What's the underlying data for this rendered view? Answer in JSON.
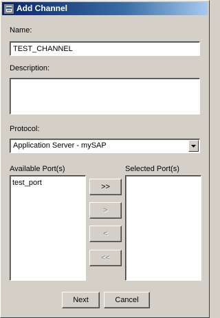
{
  "window": {
    "title": "Add Channel",
    "icon": "app-window-icon"
  },
  "form": {
    "name_label": "Name:",
    "name_value": "TEST_CHANNEL",
    "description_label": "Description:",
    "description_value": "",
    "protocol_label": "Protocol:",
    "protocol_value": "Application Server - mySAP"
  },
  "ports": {
    "available_label": "Available Port(s)",
    "selected_label": "Selected Port(s)",
    "available_items": [
      "test_port"
    ],
    "selected_items": []
  },
  "buttons": {
    "add_all": ">>",
    "add": ">",
    "remove": "<",
    "remove_all": "<<",
    "next": "Next",
    "cancel": "Cancel"
  }
}
